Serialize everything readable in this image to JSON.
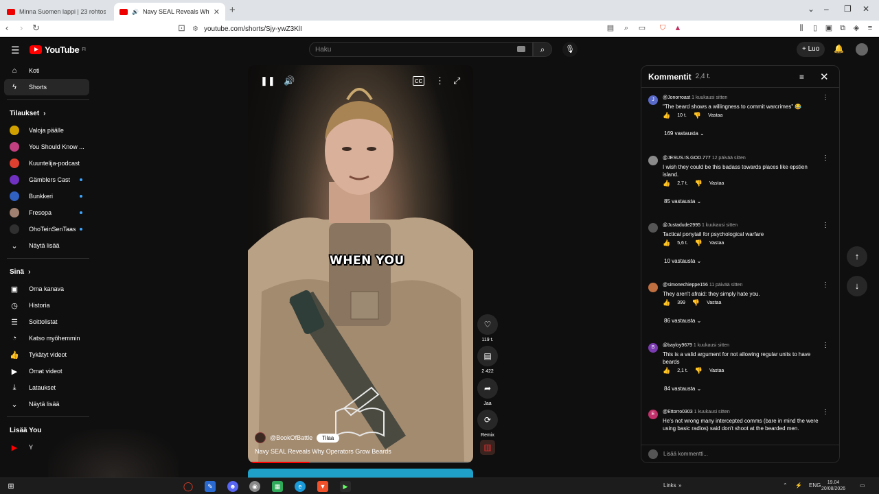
{
  "browser": {
    "tabs": [
      {
        "title": "Minna Suomen lappi | 23 rohtos - H",
        "active": false
      },
      {
        "title": "Navy SEAL Reveals Why Oper",
        "active": true
      }
    ],
    "new_tab": "+",
    "url": "youtube.com/shorts/Sjy-ywZ3KlI"
  },
  "header": {
    "logo_text": "YouTube",
    "logo_region": "FI",
    "search_placeholder": "Haku",
    "create_label": "+ Luo"
  },
  "sidebar": {
    "primary": [
      {
        "label": "Koti",
        "icon": "home-icon"
      },
      {
        "label": "Shorts",
        "icon": "shorts-icon",
        "active": true
      }
    ],
    "subscriptions_title": "Tilaukset",
    "subscriptions": [
      {
        "label": "Valoja päälle",
        "color": "#d0a000",
        "new": false
      },
      {
        "label": "You Should Know ...",
        "color": "#c04080",
        "new": false
      },
      {
        "label": "Kuuntelija-podcast",
        "color": "#e04030",
        "new": false
      },
      {
        "label": "Gämblers Cast",
        "color": "#7030c0",
        "new": true
      },
      {
        "label": "Bunkkeri",
        "color": "#3060c0",
        "new": true
      },
      {
        "label": "Fresopa",
        "color": "#a08070",
        "new": true
      },
      {
        "label": "OhoTeinSenTaas",
        "color": "#303030",
        "new": true
      }
    ],
    "show_more_subs": "Näytä lisää",
    "you_title": "Sinä",
    "you_items": [
      {
        "label": "Oma kanava",
        "icon": "user-icon"
      },
      {
        "label": "Historia",
        "icon": "history-icon"
      },
      {
        "label": "Soittolistat",
        "icon": "playlist-icon"
      },
      {
        "label": "Katso myöhemmin",
        "icon": "clock-icon"
      },
      {
        "label": "Tykätyt videot",
        "icon": "like-icon"
      },
      {
        "label": "Omat videot",
        "icon": "video-icon"
      },
      {
        "label": "Lataukset",
        "icon": "download-icon"
      },
      {
        "label": "Näytä lisää",
        "icon": "chevron-down-icon"
      }
    ],
    "more_title": "Lisää You",
    "more_items": [
      {
        "label": "Y",
        "icon": "youtube-premium-icon"
      }
    ]
  },
  "short": {
    "caption": "WHEN YOU",
    "channel": "@BookOfBattle",
    "subscribe_label": "Tilaa",
    "title": "Navy SEAL Reveals Why Operators Grow Beards",
    "progress": 0.27
  },
  "actions": {
    "likes": "119 t.",
    "comments": "2 422",
    "share": "Jaa",
    "remix": "Remix"
  },
  "comments_panel": {
    "title": "Kommentit",
    "count": "2,4 t.",
    "add_placeholder": "Lisää kommentti...",
    "reply_label": "Vastaa",
    "items": [
      {
        "author": "@Jonorroast",
        "time": "1 kuukausi sitten",
        "text": "\"The beard shows a willingness to commit warcrimes\" 😂",
        "likes": "10 t.",
        "replies": "169 vastausta",
        "avatar_letter": "J",
        "avatar_color": "#5a6ac8"
      },
      {
        "author": "@JESUS.IS.GOD.777",
        "time": "12 päivää sitten",
        "text": "I wish they could be this badass towards places like epstien island.",
        "likes": "2,7 t.",
        "replies": "85 vastausta",
        "avatar_letter": "",
        "avatar_color": "#8a8a8a"
      },
      {
        "author": "@Justadude2995",
        "time": "1 kuukausi sitten",
        "text": "Tactical ponytail for psychological warfare",
        "likes": "5,6 t.",
        "replies": "10 vastausta",
        "avatar_letter": "",
        "avatar_color": "#555555"
      },
      {
        "author": "@simonechieppe156",
        "time": "11 päivää sitten",
        "text": "They aren't afraid: they simply hate you.",
        "likes": "399",
        "replies": "86 vastausta",
        "avatar_letter": "",
        "avatar_color": "#c07040"
      },
      {
        "author": "@bayloy9679",
        "time": "1 kuukausi sitten",
        "text": "This is a valid argument for not allowing regular units to have beards",
        "likes": "2,1 t.",
        "replies": "84 vastausta",
        "avatar_letter": "B",
        "avatar_color": "#7a3ab0"
      },
      {
        "author": "@Ettorro0303",
        "time": "1 kuukausi sitten",
        "text": "He's not wrong many intercepted comms (bare in mind the were using basic radios) said don't shoot at the bearded men.",
        "likes": "",
        "replies": "",
        "avatar_letter": "E",
        "avatar_color": "#c0306a"
      }
    ]
  },
  "taskbar": {
    "links_label": "Links",
    "language": "ENG",
    "time": "19.04",
    "date": "20/08/2026"
  }
}
